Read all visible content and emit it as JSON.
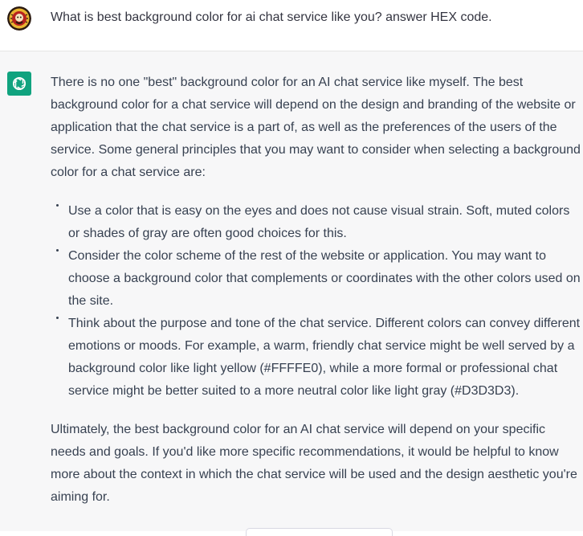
{
  "user": {
    "avatar_icon": "user-avatar-badge-icon",
    "message": "What is best background color for ai chat service like you? answer HEX code."
  },
  "assistant": {
    "avatar_icon": "openai-logo-icon",
    "avatar_color": "#10a37f",
    "intro": "There is no one \"best\" background color for an AI chat service like myself. The best background color for a chat service will depend on the design and branding of the website or application that the chat service is a part of, as well as the preferences of the users of the service. Some general principles that you may want to consider when selecting a background color for a chat service are:",
    "bullets": [
      "Use a color that is easy on the eyes and does not cause visual strain. Soft, muted colors or shades of gray are often good choices for this.",
      "Consider the color scheme of the rest of the website or application. You may want to choose a background color that complements or coordinates with the other colors used on the site.",
      "Think about the purpose and tone of the chat service. Different colors can convey different emotions or moods. For example, a warm, friendly chat service might be well served by a background color like light yellow (#FFFFE0), while a more formal or professional chat service might be better suited to a more neutral color like light gray (#D3D3D3)."
    ],
    "conclusion": "Ultimately, the best background color for an AI chat service will depend on your specific needs and goals. If you'd like more specific recommendations, it would be helpful to know more about the context in which the chat service will be used and the design aesthetic you're aiming for."
  },
  "colors": {
    "user_row_bg": "#ffffff",
    "assistant_row_bg": "#f7f7f8",
    "text": "#374151"
  }
}
